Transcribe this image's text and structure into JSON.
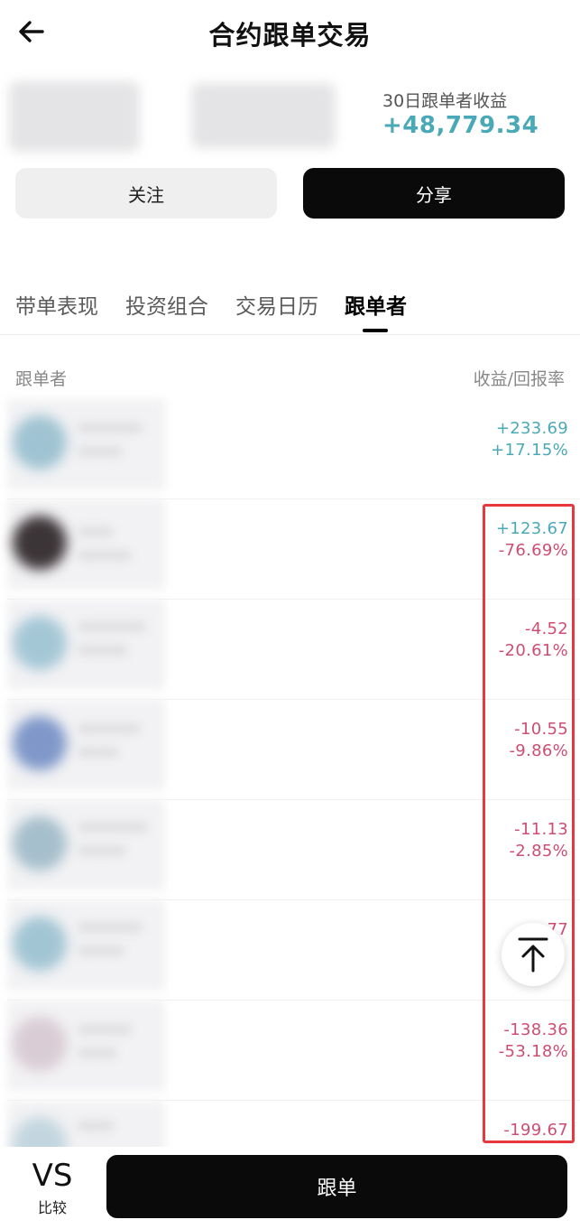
{
  "header": {
    "title": "合约跟单交易"
  },
  "profile": {
    "profit_label": "30日跟单者收益",
    "profit_value": "+48,779.34",
    "follow_label": "关注",
    "share_label": "分享"
  },
  "tabs": [
    {
      "label": "带单表现"
    },
    {
      "label": "投资组合"
    },
    {
      "label": "交易日历"
    },
    {
      "label": "跟单者"
    }
  ],
  "list": {
    "col_follower": "跟单者",
    "col_returns": "收益/回报率",
    "rows": [
      {
        "v1": "+233.69",
        "v2": "+17.15%"
      },
      {
        "v1": "+123.67",
        "v2": "-76.69%"
      },
      {
        "v1": "-4.52",
        "v2": "-20.61%"
      },
      {
        "v1": "-10.55",
        "v2": "-9.86%"
      },
      {
        "v1": "-11.13",
        "v2": "-2.85%"
      },
      {
        "v1": "77",
        "v2": ""
      },
      {
        "v1": "-138.36",
        "v2": "-53.18%"
      },
      {
        "v1": "-199.67",
        "v2": ""
      }
    ]
  },
  "bottom": {
    "vs_text": "VS",
    "vs_label": "比较",
    "copy_label": "跟单"
  },
  "colors": {
    "positive": "#4aa9b6",
    "negative": "#cf4d72",
    "highlight": "#e8383e"
  }
}
